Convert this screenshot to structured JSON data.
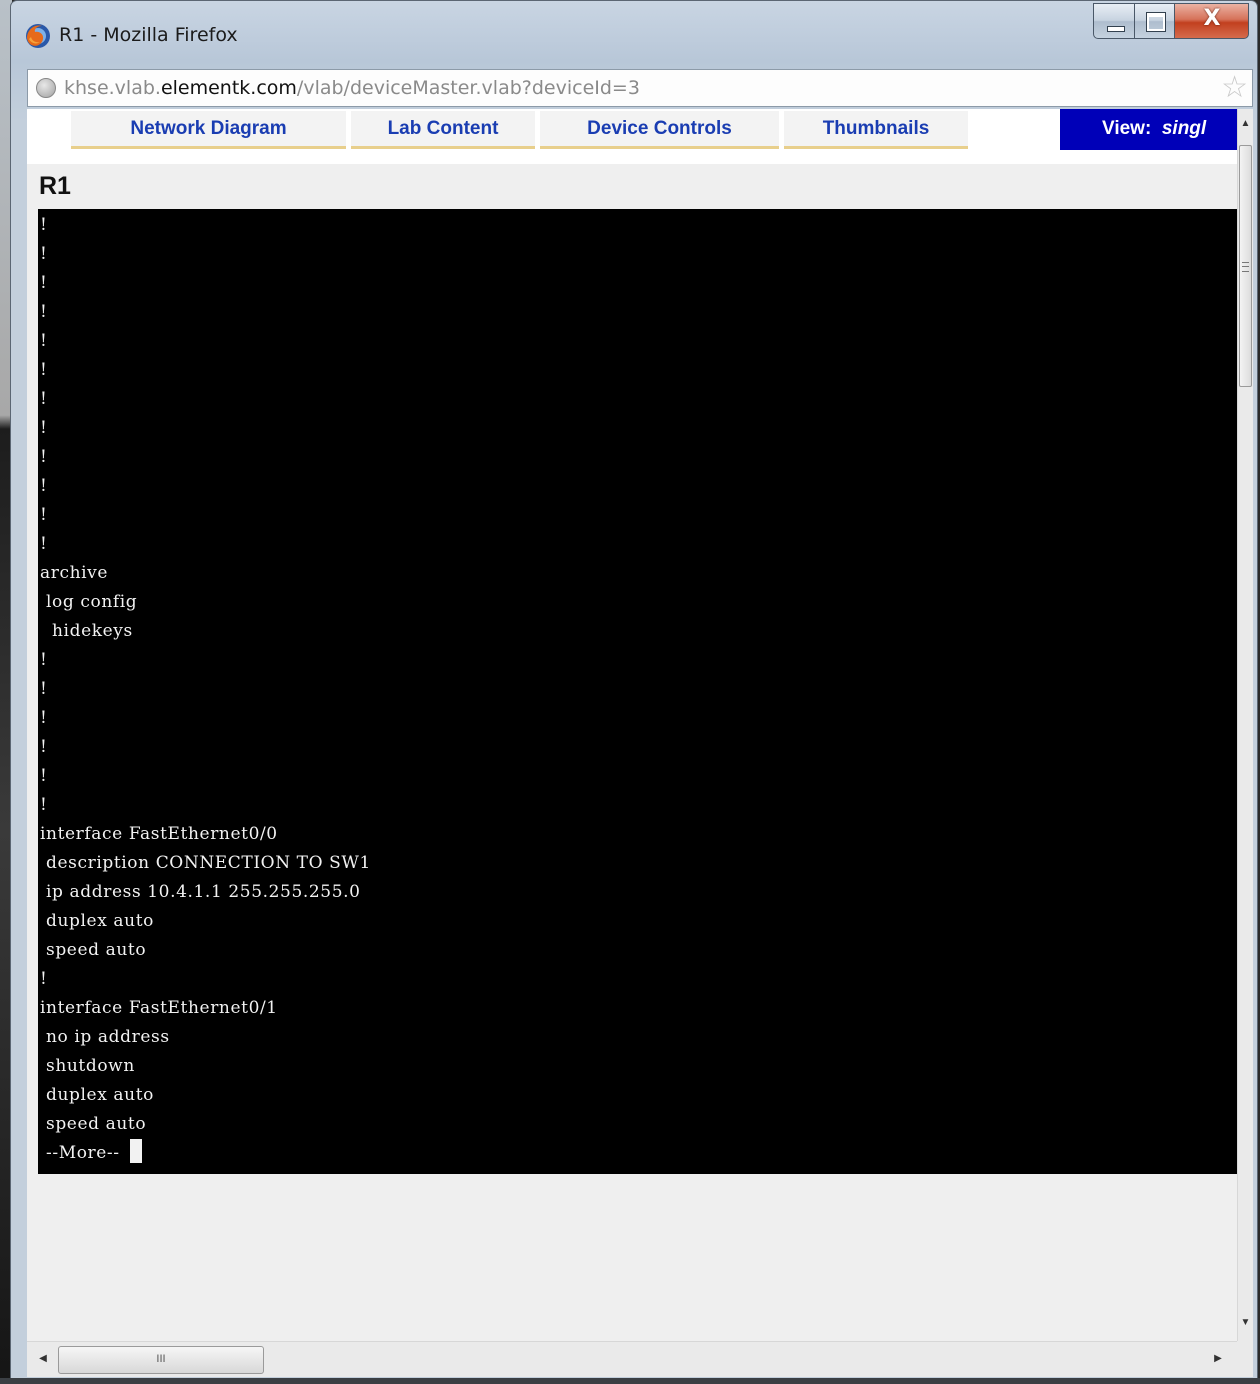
{
  "window": {
    "title": "R1 - Mozilla Firefox",
    "buttons": {
      "minimize": "minimize",
      "maximize": "maximize",
      "close": "X"
    }
  },
  "address_bar": {
    "url_prefix": "khse.vlab.",
    "url_host": "elementk.com",
    "url_path": "/vlab/deviceMaster.vlab?deviceId=3"
  },
  "nav_tabs": [
    {
      "label": "Network Diagram"
    },
    {
      "label": "Lab Content"
    },
    {
      "label": "Device Controls"
    },
    {
      "label": "Thumbnails"
    }
  ],
  "view_button": {
    "label": "View:",
    "value": "singl"
  },
  "device": {
    "name": "R1"
  },
  "terminal": {
    "lines": [
      "!",
      "!",
      "!",
      "!",
      "!",
      "!",
      "!",
      "!",
      "!",
      "!",
      "!",
      "!",
      "archive",
      " log config",
      "  hidekeys",
      "!",
      "!",
      "!",
      "!",
      "!",
      "!",
      "interface FastEthernet0/0",
      " description CONNECTION TO SW1",
      " ip address 10.4.1.1 255.255.255.0",
      " duplex auto",
      " speed auto",
      "!",
      "interface FastEthernet0/1",
      " no ip address",
      " shutdown",
      " duplex auto",
      " speed auto",
      " --More-- "
    ]
  },
  "scrollbar": {
    "h_thumb_grip": "III"
  },
  "colors": {
    "tab_text": "#1a3db2",
    "view_button_bg": "#0000b8",
    "terminal_bg": "#000000",
    "terminal_text": "#f2f2f2",
    "tab_underline": "#e8cf8c"
  }
}
